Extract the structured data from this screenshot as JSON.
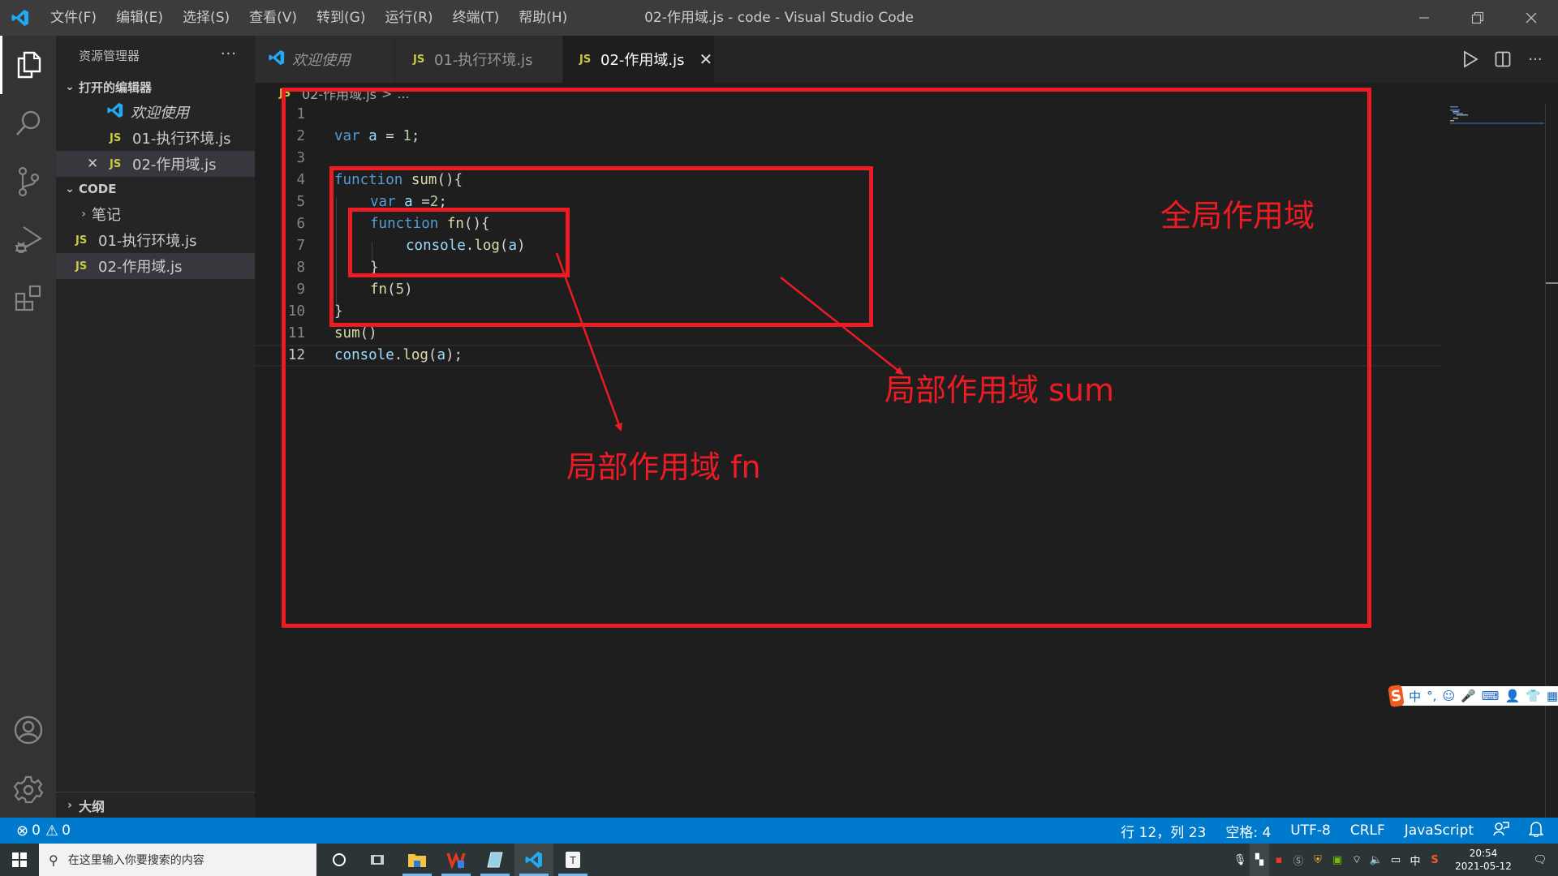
{
  "titlebar": {
    "menus": [
      "文件(F)",
      "编辑(E)",
      "选择(S)",
      "查看(V)",
      "转到(G)",
      "运行(R)",
      "终端(T)",
      "帮助(H)"
    ],
    "window_title": "02-作用域.js - code - Visual Studio Code"
  },
  "activitybar": {
    "items": [
      "explorer",
      "search",
      "source-control",
      "run-debug",
      "extensions"
    ],
    "bottom": [
      "accounts",
      "manage"
    ]
  },
  "sidebar": {
    "title": "资源管理器",
    "more": "···",
    "open_editors": {
      "title": "打开的编辑器",
      "items": [
        {
          "label": "欢迎使用",
          "icon": "vscode-icon"
        },
        {
          "label": "01-执行环境.js",
          "icon": "JS"
        },
        {
          "label": "02-作用域.js",
          "icon": "JS",
          "close": "✕"
        }
      ]
    },
    "folder": {
      "title": "CODE",
      "items": [
        {
          "label": "笔记",
          "type": "folder"
        },
        {
          "label": "01-执行环境.js",
          "icon": "JS"
        },
        {
          "label": "02-作用域.js",
          "icon": "JS"
        }
      ]
    },
    "outline": "大纲"
  },
  "tabs": [
    {
      "label": "欢迎使用",
      "icon": "vscode-icon"
    },
    {
      "label": "01-执行环境.js",
      "icon": "JS"
    },
    {
      "label": "02-作用域.js",
      "icon": "JS",
      "close": "✕",
      "active": true
    }
  ],
  "breadcrumb": {
    "icon": "JS",
    "file": "02-作用域.js",
    "sep": ">",
    "rest": "..."
  },
  "editor": {
    "lines": [
      {
        "n": "1"
      },
      {
        "n": "2"
      },
      {
        "n": "3"
      },
      {
        "n": "4"
      },
      {
        "n": "5"
      },
      {
        "n": "6"
      },
      {
        "n": "7"
      },
      {
        "n": "8"
      },
      {
        "n": "9"
      },
      {
        "n": "10"
      },
      {
        "n": "11"
      },
      {
        "n": "12"
      }
    ],
    "tokens": {
      "l2": [
        "var",
        " ",
        "a",
        " = ",
        "1",
        ";"
      ],
      "l4": [
        "function",
        " ",
        "sum",
        "(){"
      ],
      "l5": [
        "var",
        " ",
        "a",
        " =",
        "2",
        ";"
      ],
      "l6": [
        "function",
        " ",
        "fn",
        "(){"
      ],
      "l7": [
        "console",
        ".",
        "log",
        "(",
        "a",
        ")"
      ],
      "l8": [
        "}"
      ],
      "l9": [
        "fn",
        "(",
        "5",
        ")"
      ],
      "l10": [
        "}"
      ],
      "l11": [
        "sum",
        "()"
      ],
      "l12": [
        "console",
        ".",
        "log",
        "(",
        "a",
        ");"
      ]
    }
  },
  "annotations": {
    "global": "全局作用域",
    "local_sum": "局部作用域 sum",
    "local_fn": "局部作用域 fn",
    "color": "#ed1c24"
  },
  "ime": {
    "logo": "S",
    "items": [
      "中",
      "°,",
      "☺",
      "🎤",
      "⌨",
      "👤",
      "👕",
      "▦"
    ]
  },
  "statusbar": {
    "errors": "0",
    "warnings": "0",
    "position": "行 12，列 23",
    "spaces": "空格: 4",
    "encoding": "UTF-8",
    "eol": "CRLF",
    "language": "JavaScript",
    "color": "#007acc"
  },
  "taskbar": {
    "search_placeholder": "在这里输入你要搜索的内容",
    "tray_ime": "中",
    "time": "20:54",
    "date": "2021-05-12"
  }
}
